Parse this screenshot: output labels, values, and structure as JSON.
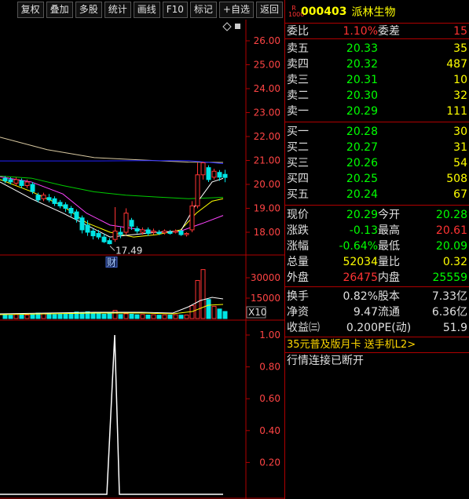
{
  "toolbar": {
    "buttons": [
      "复权",
      "叠加",
      "多股",
      "统计",
      "画线",
      "F10",
      "标记",
      "+自选",
      "返回"
    ]
  },
  "chart": {
    "price_ticks": [
      "26.00",
      "25.00",
      "24.00",
      "23.00",
      "22.00",
      "21.00",
      "20.00",
      "19.00",
      "18.00"
    ],
    "volume_ticks": [
      "30000",
      "15000"
    ],
    "volume_unit": "X10",
    "indicator_ticks": [
      "1.00",
      "0.80",
      "0.60",
      "0.40",
      "0.20"
    ],
    "low_label": "17.49",
    "event_mark": "财",
    "colors": {
      "up": "#ff3333",
      "down": "#00e5e5",
      "ma1": "#ffffff",
      "ma2": "#ffff00",
      "ma3": "#ff44ff",
      "ma4": "#00cc00",
      "ma5": "#2222ff",
      "ma6": "#d8c8a0",
      "grid": "#b00000"
    }
  },
  "quote": {
    "r_badge_top": "R",
    "r_badge_bottom": "1000",
    "code": "000403",
    "name": "派林生物",
    "weibi_label": "委比",
    "weibi_value": "1.10%",
    "weicha_label": "委差",
    "weicha_value": "15",
    "asks": [
      {
        "label": "卖五",
        "price": "20.33",
        "vol": "35"
      },
      {
        "label": "卖四",
        "price": "20.32",
        "vol": "487"
      },
      {
        "label": "卖三",
        "price": "20.31",
        "vol": "10"
      },
      {
        "label": "卖二",
        "price": "20.30",
        "vol": "32"
      },
      {
        "label": "卖一",
        "price": "20.29",
        "vol": "111"
      }
    ],
    "bids": [
      {
        "label": "买一",
        "price": "20.28",
        "vol": "30"
      },
      {
        "label": "买二",
        "price": "20.27",
        "vol": "31"
      },
      {
        "label": "买三",
        "price": "20.26",
        "vol": "54"
      },
      {
        "label": "买四",
        "price": "20.25",
        "vol": "508"
      },
      {
        "label": "买五",
        "price": "20.24",
        "vol": "67"
      }
    ],
    "stats": [
      {
        "l1": "现价",
        "v1": "20.29",
        "c1": "green",
        "l2": "今开",
        "v2": "20.28",
        "c2": "green"
      },
      {
        "l1": "涨跌",
        "v1": "-0.13",
        "c1": "green",
        "l2": "最高",
        "v2": "20.61",
        "c2": "red"
      },
      {
        "l1": "涨幅",
        "v1": "-0.64%",
        "c1": "green",
        "l2": "最低",
        "v2": "20.09",
        "c2": "green"
      },
      {
        "l1": "总量",
        "v1": "52034",
        "c1": "yellow",
        "l2": "量比",
        "v2": "0.32",
        "c2": "yellow"
      },
      {
        "l1": "外盘",
        "v1": "26475",
        "c1": "red",
        "l2": "内盘",
        "v2": "25559",
        "c2": "green"
      }
    ],
    "fundamentals": [
      {
        "l1": "换手",
        "v1": "0.82%",
        "l2": "股本",
        "v2": "7.33亿"
      },
      {
        "l1": "净资",
        "v1": "9.47",
        "l2": "流通",
        "v2": "6.36亿"
      },
      {
        "l1": "收益㈢",
        "v1": "0.200",
        "l2": "PE(动)",
        "v2": "51.9"
      }
    ],
    "promo": "35元普及版月卡 送手机L2>",
    "status": "行情连接已断开"
  }
}
